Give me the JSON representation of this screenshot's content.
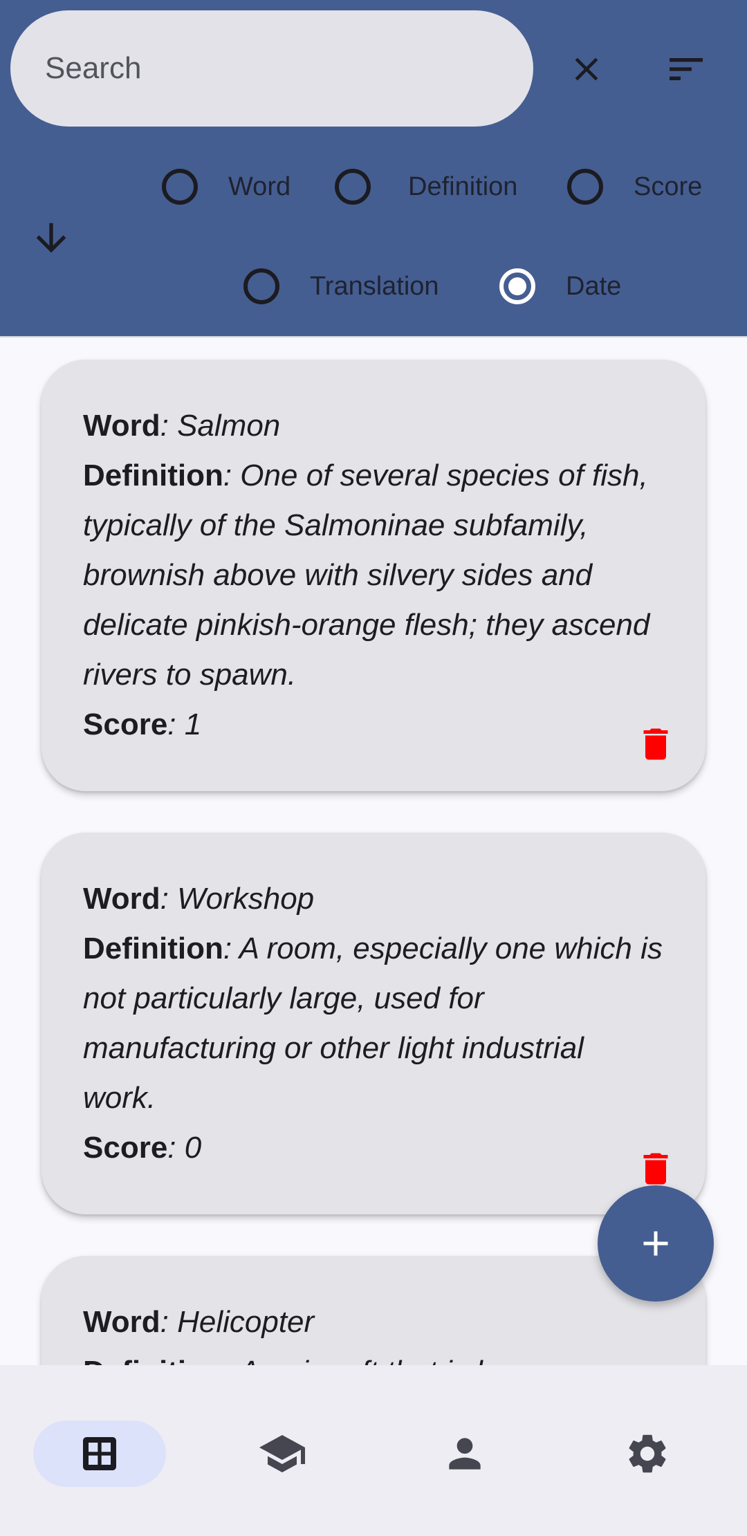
{
  "search": {
    "placeholder": "Search",
    "value": ""
  },
  "header": {
    "close_icon": "close-icon",
    "filter_icon": "sort-lines-icon",
    "sort_direction_icon": "arrow-down-icon"
  },
  "sort_options": [
    {
      "label": "Word",
      "selected": false
    },
    {
      "label": "Definition",
      "selected": false
    },
    {
      "label": "Score",
      "selected": false
    },
    {
      "label": "Translation",
      "selected": false
    },
    {
      "label": "Date",
      "selected": true
    }
  ],
  "cards": [
    {
      "word_label": "Word",
      "word_value": ": Salmon",
      "definition_label": "Definition",
      "definition_value": ": One of several species of fish, typically of the Salmoninae subfamily, brownish above with silvery sides and delicate pinkish-orange flesh; they ascend rivers to spawn.",
      "score_label": "Score",
      "score_value": ": 1"
    },
    {
      "word_label": "Word",
      "word_value": ": Workshop",
      "definition_label": "Definition",
      "definition_value": ": A room, especially one which is not particularly large, used for manufacturing or other light industrial work.",
      "score_label": "Score",
      "score_value": ": 0"
    },
    {
      "word_label": "Word",
      "word_value": ": Helicopter",
      "definition_label": "Definition",
      "definition_value": ": An aircraft that is borne"
    }
  ],
  "bottom_nav": [
    {
      "icon": "grid-icon",
      "active": true
    },
    {
      "icon": "graduation-cap-icon",
      "active": false
    },
    {
      "icon": "person-icon",
      "active": false
    },
    {
      "icon": "gear-icon",
      "active": false
    }
  ],
  "colors": {
    "header": "#455e91",
    "card": "#e4e3e8",
    "delete": "#ff0000",
    "fab": "#455e91",
    "nav_active": "#dce2f9"
  }
}
